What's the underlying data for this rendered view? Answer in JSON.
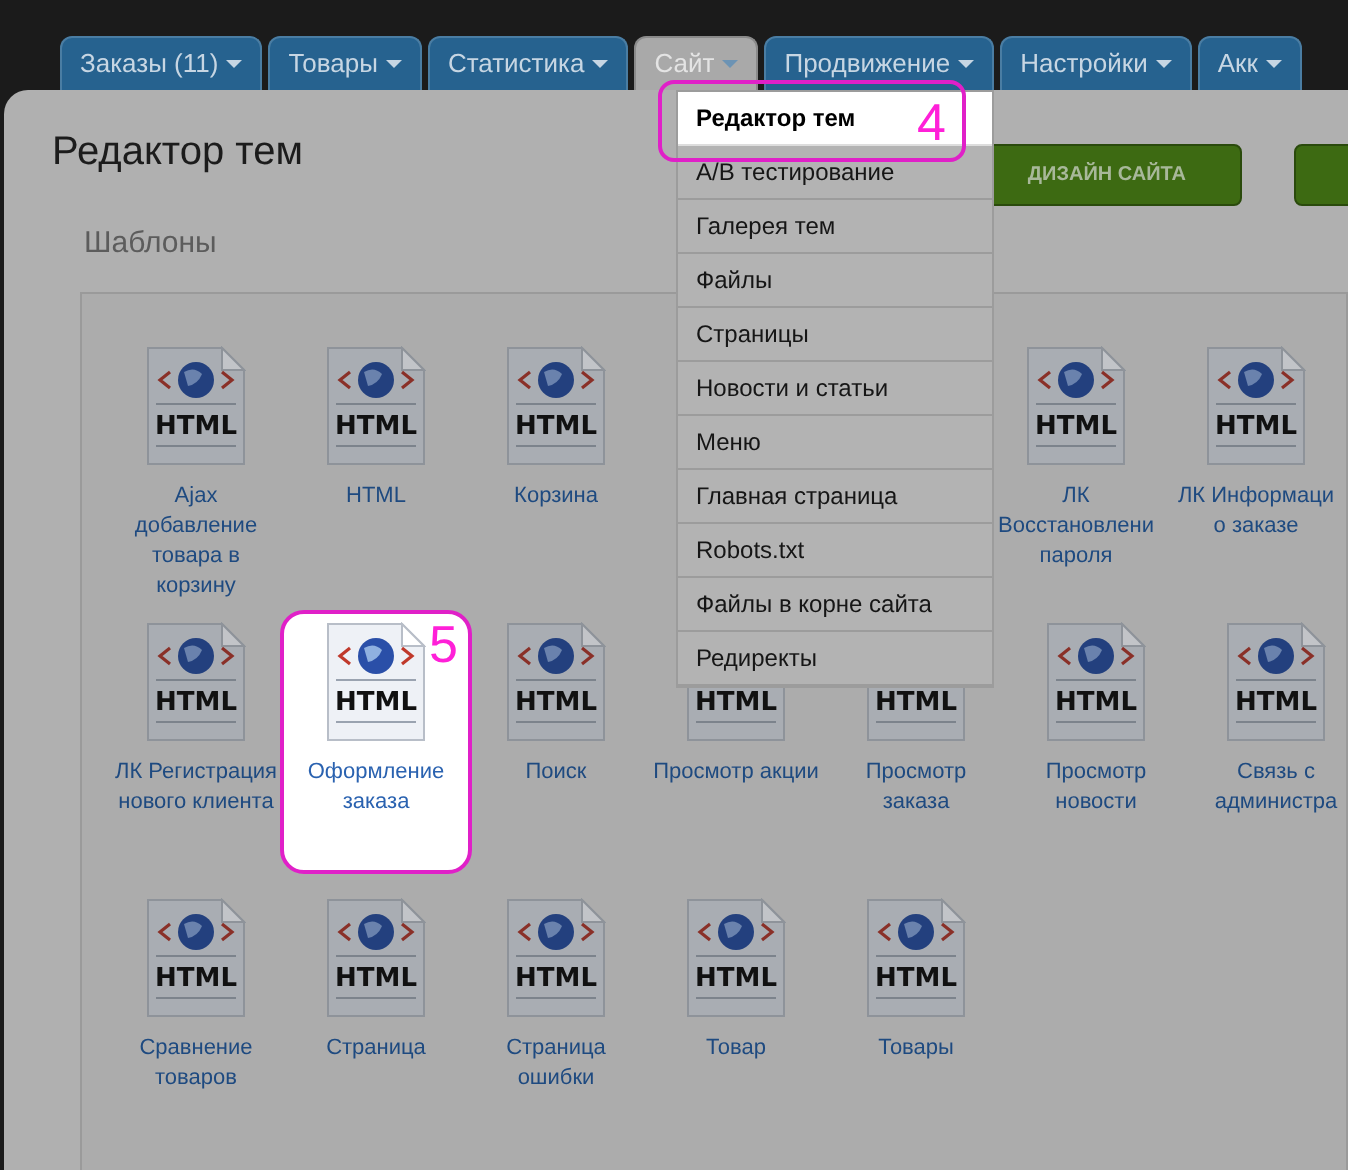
{
  "tabs": [
    {
      "label": "Заказы (11)",
      "selected": false
    },
    {
      "label": "Товары",
      "selected": false
    },
    {
      "label": "Статистика",
      "selected": false
    },
    {
      "label": "Сайт",
      "selected": true
    },
    {
      "label": "Продвижение",
      "selected": false
    },
    {
      "label": "Настройки",
      "selected": false
    },
    {
      "label": "Акк",
      "selected": false
    }
  ],
  "page": {
    "title": "Редактор тем",
    "section": "Шаблоны",
    "buttons": [
      "ДИЗАЙН САЙТА"
    ]
  },
  "menu": {
    "open": true,
    "items": [
      {
        "label": "Редактор тем",
        "selected": true,
        "callout": "4"
      },
      {
        "label": "A/B тестирование",
        "selected": false
      },
      {
        "label": "Галерея тем",
        "selected": false
      },
      {
        "label": "Файлы",
        "selected": false
      },
      {
        "label": "Страницы",
        "selected": false
      },
      {
        "label": "Новости и статьи",
        "selected": false
      },
      {
        "label": "Меню",
        "selected": false
      },
      {
        "label": "Главная страница",
        "selected": false
      },
      {
        "label": "Robots.txt",
        "selected": false
      },
      {
        "label": "Файлы в корне сайта",
        "selected": false
      },
      {
        "label": "Редиректы",
        "selected": false
      }
    ]
  },
  "templates": [
    [
      {
        "label": "Ajax добавление товара в корзину",
        "icon_text": "HTML",
        "selected": false
      },
      {
        "label": "HTML",
        "icon_text": "HTML",
        "selected": false
      },
      {
        "label": "Корзина",
        "icon_text": "HTML",
        "selected": false
      },
      {
        "label": "ЛК Восстановлени пароля",
        "icon_text": "HTML",
        "selected": false
      },
      {
        "label": "ЛК Информаци о заказе",
        "icon_text": "HTML",
        "selected": false
      }
    ],
    [
      {
        "label": "ЛК Регистрация нового клиента",
        "icon_text": "HTML",
        "selected": false
      },
      {
        "label": "Оформление заказа",
        "icon_text": "HTML",
        "selected": true,
        "callout": "5"
      },
      {
        "label": "Поиск",
        "icon_text": "HTML",
        "selected": false
      },
      {
        "label": "Просмотр акции",
        "icon_text": "HTML",
        "selected": false
      },
      {
        "label": "Просмотр заказа",
        "icon_text": "HTML",
        "selected": false
      },
      {
        "label": "Просмотр новости",
        "icon_text": "HTML",
        "selected": false
      },
      {
        "label": "Связь с администра",
        "icon_text": "HTML",
        "selected": false
      }
    ],
    [
      {
        "label": "Сравнение товаров",
        "icon_text": "HTML",
        "selected": false
      },
      {
        "label": "Страница",
        "icon_text": "HTML",
        "selected": false
      },
      {
        "label": "Страница ошибки",
        "icon_text": "HTML",
        "selected": false
      },
      {
        "label": "Товар",
        "icon_text": "HTML",
        "selected": false
      },
      {
        "label": "Товары",
        "icon_text": "HTML",
        "selected": false
      }
    ]
  ]
}
